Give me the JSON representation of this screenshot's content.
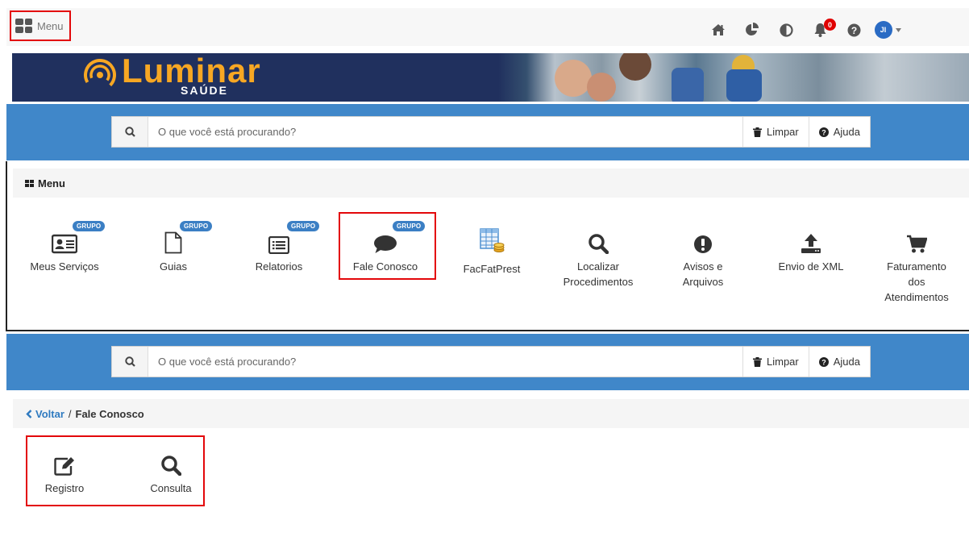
{
  "topbar": {
    "menu_label": "Menu",
    "icons": [
      "home-icon",
      "chart-pie-icon",
      "contrast-icon",
      "bell-icon",
      "help-icon"
    ],
    "notification_count": "0",
    "avatar_initials": "JI"
  },
  "banner": {
    "brand_name": "Luminar",
    "brand_sub": "SAÚDE"
  },
  "search": {
    "placeholder": "O que você está procurando?",
    "clear_label": "Limpar",
    "help_label": "Ajuda"
  },
  "menu_panel": {
    "title": "Menu",
    "tiles": [
      {
        "label": "Meus Serviços",
        "badge": "GRUPO",
        "icon": "id-card-icon"
      },
      {
        "label": "Guias",
        "badge": "GRUPO",
        "icon": "file-icon"
      },
      {
        "label": "Relatorios",
        "badge": "GRUPO",
        "icon": "list-icon"
      },
      {
        "label": "Fale Conosco",
        "badge": "GRUPO",
        "icon": "comment-icon"
      },
      {
        "label": "FacFatPrest",
        "badge": "",
        "icon": "spreadsheet-coins-icon"
      },
      {
        "label": "Localizar Procedimentos",
        "badge": "",
        "icon": "search-icon"
      },
      {
        "label": "Avisos e Arquivos",
        "badge": "",
        "icon": "exclamation-circle-icon"
      },
      {
        "label": "Envio de XML",
        "badge": "",
        "icon": "upload-icon"
      },
      {
        "label": "Faturamento dos Atendimentos",
        "badge": "",
        "icon": "cart-icon"
      }
    ]
  },
  "breadcrumb": {
    "back_label": "Voltar",
    "current": "Fale Conosco"
  },
  "submenu": {
    "tiles": [
      {
        "label": "Registro",
        "icon": "edit-icon"
      },
      {
        "label": "Consulta",
        "icon": "search-icon"
      }
    ]
  }
}
